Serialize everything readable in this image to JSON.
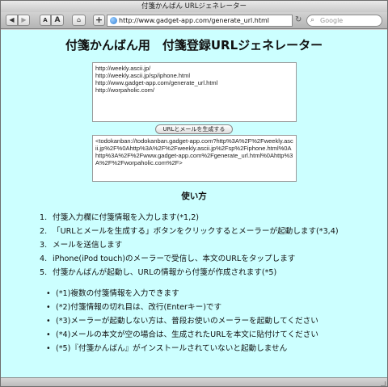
{
  "window": {
    "title": "付箋かんばん URLジェネレーター"
  },
  "toolbar": {
    "back_glyph": "◀",
    "forward_glyph": "▶",
    "zoom_small": "A",
    "zoom_large": "A",
    "home_glyph": "⌂",
    "add_glyph": "+",
    "url": "http://www.gadget-app.com/generate_url.html",
    "reload_glyph": "↻",
    "search_placeholder": "Google",
    "search_glyph": "⌕"
  },
  "page": {
    "heading": "付箋かんばん用　付箋登録URLジェネレーター",
    "input_text": "http://weekly.ascii.jp/\nhttp://weekly.ascii.jp/sp/iphone.html\nhttp://www.gadget-app.com/generate_url.html\nhttp://worpaholic.com/",
    "generate_button": "URLとメールを生成する",
    "output_text": "<todokanban://todokanban.gadget-app.com?http%3A%2F%2Fweekly.ascii.jp%2F%0Ahttp%3A%2F%2Fweekly.ascii.jp%2Fsp%2Fiphone.html%0Ahttp%3A%2F%2Fwww.gadget-app.com%2Fgenerate_url.html%0Ahttp%3A%2F%2Fworpaholic.com%2F>",
    "how_title": "使い方",
    "steps": [
      {
        "num": "1.",
        "text": "付箋入力欄に付箋情報を入力します(*1,2)"
      },
      {
        "num": "2.",
        "text": "「URLとメールを生成する」ボタンをクリックするとメーラーが起動します(*3,4)"
      },
      {
        "num": "3.",
        "text": "メールを送信します"
      },
      {
        "num": "4.",
        "text": "iPhone(iPod touch)のメーラーで受信し、本文のURLをタップします"
      },
      {
        "num": "5.",
        "text": "付箋かんばんが起動し、URLの情報から付箋が作成されます(*5)"
      }
    ],
    "notes": [
      {
        "dot": "•",
        "text": "(*1)複数の付箋情報を入力できます"
      },
      {
        "dot": "•",
        "text": "(*2)付箋情報の切れ目は、改行(Enterキー)です"
      },
      {
        "dot": "•",
        "text": "(*3)メーラーが起動しない方は、普段お使いのメーラーを起動してください"
      },
      {
        "dot": "•",
        "text": "(*4)メールの本文が空の場合は、生成されたURLを本文に貼付けてください"
      },
      {
        "dot": "•",
        "text": "(*5)『付箋かんばん』がインストールされていないと起動しません"
      }
    ]
  }
}
